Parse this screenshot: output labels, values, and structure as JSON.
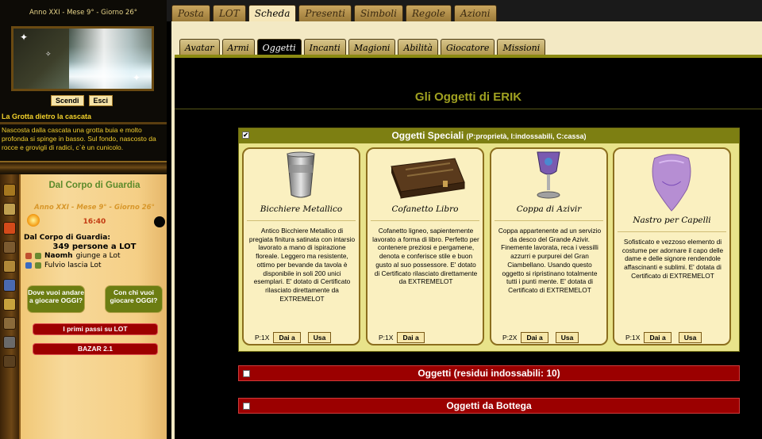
{
  "left": {
    "date": "Anno XXI - Mese 9° - Giorno 26°",
    "search_btn": "Scendi",
    "exit_btn": "Esci",
    "location_title": "La Grotta dietro la cascata",
    "location_desc": "Nascosta dalla cascata una grotta buia e molto profonda si spinge in basso. Sul fondo, nascosto da rocce e grovigli di radici, c`è un cunicolo.",
    "guard": {
      "title": "Dal Corpo di Guardia",
      "date": "Anno XXI - Mese 9° - Giorno 26°",
      "time": "16:40",
      "sub": "Dal Corpo di Guardia:",
      "count": "349 persone a LOT",
      "event1_name": "Naomh",
      "event1_action": "giunge a Lot",
      "event2_text": "Fulvio lascia Lot",
      "btn_where": "Dove vuoi andare a giocare OGGI?",
      "btn_with": "Con chi vuoi giocare OGGI?",
      "link1": "I primi passi su LOT",
      "link2": "BAZAR 2.1"
    },
    "icons": [
      "sword-icon",
      "book-icon",
      "flame-icon",
      "person-icon",
      "scroll-icon",
      "gem-icon",
      "key-icon",
      "map-icon",
      "dagger-icon",
      "chest-icon"
    ]
  },
  "top_tabs": [
    {
      "label": "Posta",
      "active": false
    },
    {
      "label": "LOT",
      "active": false
    },
    {
      "label": "Scheda",
      "active": true
    },
    {
      "label": "Presenti",
      "active": false
    },
    {
      "label": "Simboli",
      "active": false
    },
    {
      "label": "Regole",
      "active": false
    },
    {
      "label": "Azioni",
      "active": false
    }
  ],
  "sub_tabs": [
    {
      "label": "Avatar",
      "active": false
    },
    {
      "label": "Armi",
      "active": false
    },
    {
      "label": "Oggetti",
      "active": true
    },
    {
      "label": "Incanti",
      "active": false
    },
    {
      "label": "Magioni",
      "active": false
    },
    {
      "label": "Abilità",
      "active": false
    },
    {
      "label": "Giocatore",
      "active": false
    },
    {
      "label": "Missioni",
      "active": false
    }
  ],
  "main": {
    "title": "Gli Oggetti di ERIK",
    "special": {
      "title": "Oggetti Speciali",
      "legend": "(P:proprietà, I:indossabili, C:cassa)",
      "items": [
        {
          "name": "Bicchiere Metallico",
          "desc": "Antico Bicchiere Metallico di pregiata finitura satinata con intarsio lavorato a mano di ispirazione floreale. Leggero ma resistente, ottimo per bevande da tavola è disponibile in soli 200 unici esemplari. E' dotato di Certificato rilasciato direttamente da EXTREMELOT",
          "qty": "P:1X",
          "btn_give": "Dai a",
          "btn_use": "Usa"
        },
        {
          "name": "Cofanetto Libro",
          "desc": "Cofanetto ligneo, sapientemente lavorato a forma di libro. Perfetto per contenere preziosi e pergamene, denota e conferisce stile e buon gusto al suo possessore. E' dotato di Certificato rilasciato direttamente da EXTREMELOT",
          "qty": "P:1X",
          "btn_give": "Dai a",
          "btn_use": ""
        },
        {
          "name": "Coppa di Azivir",
          "desc": "Coppa appartenente ad un servizio da desco del Grande Azivir. Finemente lavorata, reca i vessilli azzurri e purpurei del Gran Ciambellano. Usando questo oggetto si ripristinano totalmente tutti i punti mente. E' dotata di Certificato di EXTREMELOT",
          "qty": "P:2X",
          "btn_give": "Dai a",
          "btn_use": "Usa"
        },
        {
          "name": "Nastro per Capelli",
          "desc": "Sofisticato e vezzoso elemento di costume per adornare il capo delle dame e delle signore rendendole affascinanti e sublimi. E' dotata di Certificato di EXTREMELOT",
          "qty": "P:1X",
          "btn_give": "Dai a",
          "btn_use": "Usa"
        }
      ]
    },
    "worn": {
      "title": "Oggetti (residui indossabili: 10)"
    },
    "shop": {
      "title": "Oggetti da Bottega"
    }
  },
  "colors": {
    "olive": "#7d7f12",
    "red_bar": "#9b0000",
    "cream": "#f3e9c4",
    "card": "#faf0c0"
  }
}
